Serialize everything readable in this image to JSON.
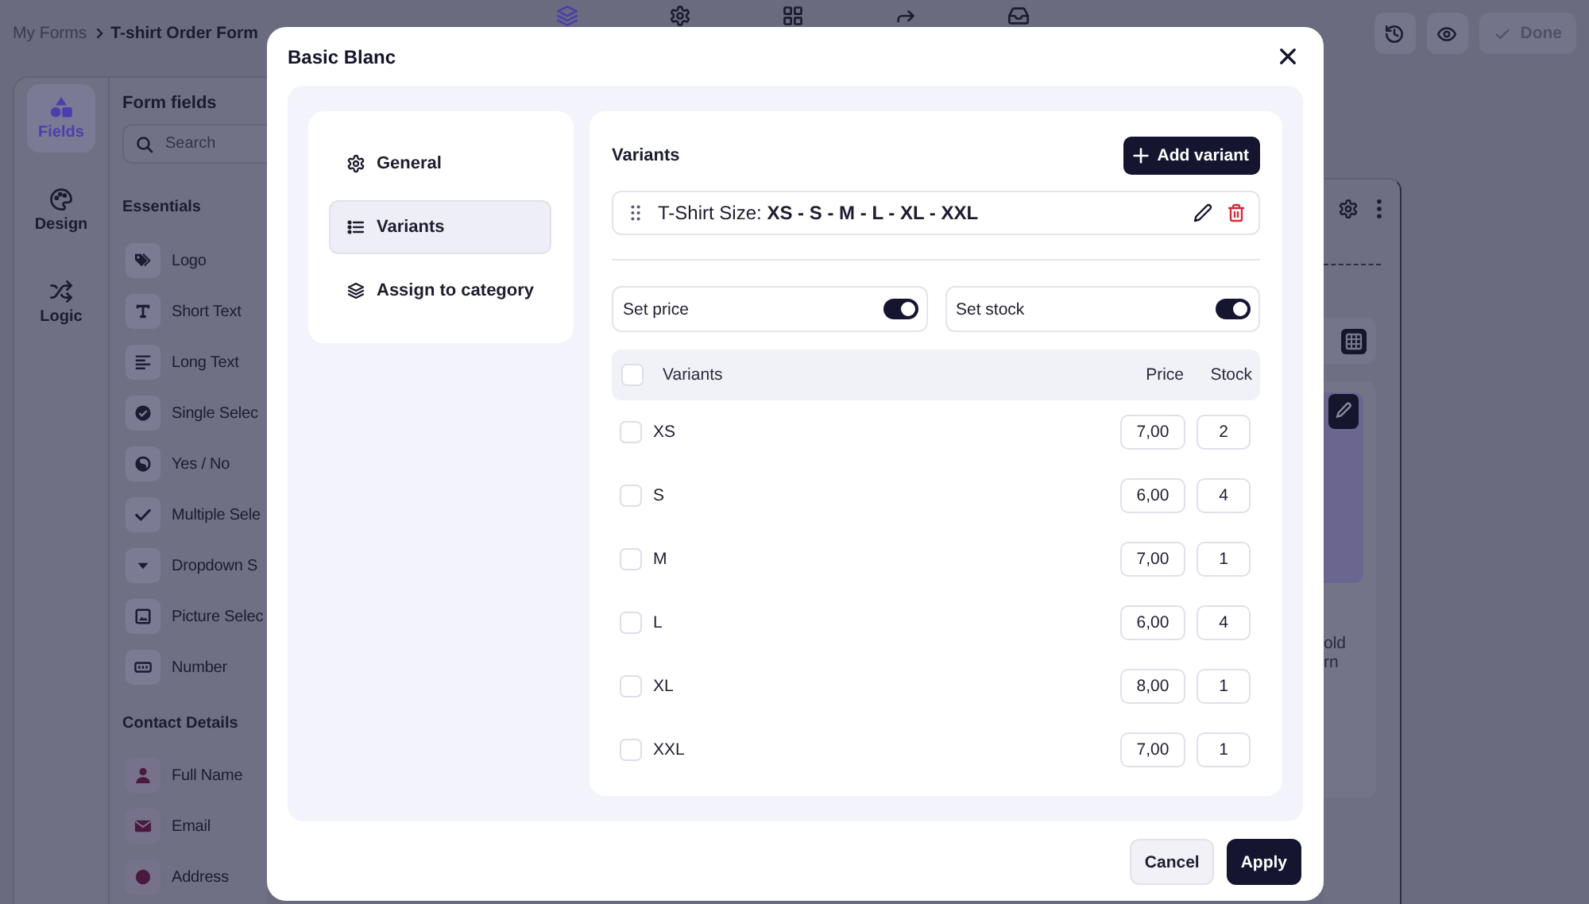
{
  "topbar": {
    "breadcrumb": [
      "My Forms",
      "T-shirt Order Form"
    ],
    "tools": [
      {
        "selected": true
      },
      {
        "selected": false
      },
      {
        "selected": false
      },
      {
        "selected": false
      },
      {
        "selected": false
      }
    ],
    "done_button": {
      "label": "Done",
      "disabled": true
    }
  },
  "rail": [
    {
      "label": "Fields",
      "selected": true
    },
    {
      "label": "Design",
      "selected": false
    },
    {
      "label": "Logic",
      "selected": false
    }
  ],
  "form_fields": {
    "title": "Form fields",
    "search": {
      "placeholder": "Search"
    },
    "groups": [
      {
        "title": "Essentials",
        "items": [
          "Logo",
          "Short Text",
          "Long Text",
          "Single Selec",
          "Yes / No",
          "Multiple Sele",
          "Dropdown S",
          "Picture Selec",
          "Number"
        ]
      },
      {
        "title": "Contact Details",
        "items": [
          "Full Name",
          "Email",
          "Address"
        ]
      }
    ]
  },
  "canvas": {
    "caption_lines": [
      "old",
      "rn"
    ]
  },
  "modal": {
    "title": "Basic Blanc",
    "nav": [
      {
        "label": "General",
        "selected": false
      },
      {
        "label": "Variants",
        "selected": true
      },
      {
        "label": "Assign to category",
        "selected": false
      }
    ],
    "section_title": "Variants",
    "add_button": "Add variant",
    "variant_group": "T-Shirt Size: **XS - S - M - L - XL - XXL**",
    "toggles": [
      {
        "label": "Set price",
        "on": true
      },
      {
        "label": "Set stock",
        "on": true
      }
    ],
    "table": {
      "select_all_checked": false,
      "columns": [
        "Variants",
        "Price",
        "Stock"
      ],
      "rows": [
        {
          "name": "XS",
          "price": "7,00",
          "stock": "2",
          "checked": false
        },
        {
          "name": "S",
          "price": "6,00",
          "stock": "4",
          "checked": false
        },
        {
          "name": "M",
          "price": "7,00",
          "stock": "1",
          "checked": false
        },
        {
          "name": "L",
          "price": "6,00",
          "stock": "4",
          "checked": false
        },
        {
          "name": "XL",
          "price": "8,00",
          "stock": "1",
          "checked": false
        },
        {
          "name": "XXL",
          "price": "7,00",
          "stock": "1",
          "checked": false
        }
      ]
    },
    "buttons": {
      "cancel": "Cancel",
      "apply": "Apply"
    }
  }
}
